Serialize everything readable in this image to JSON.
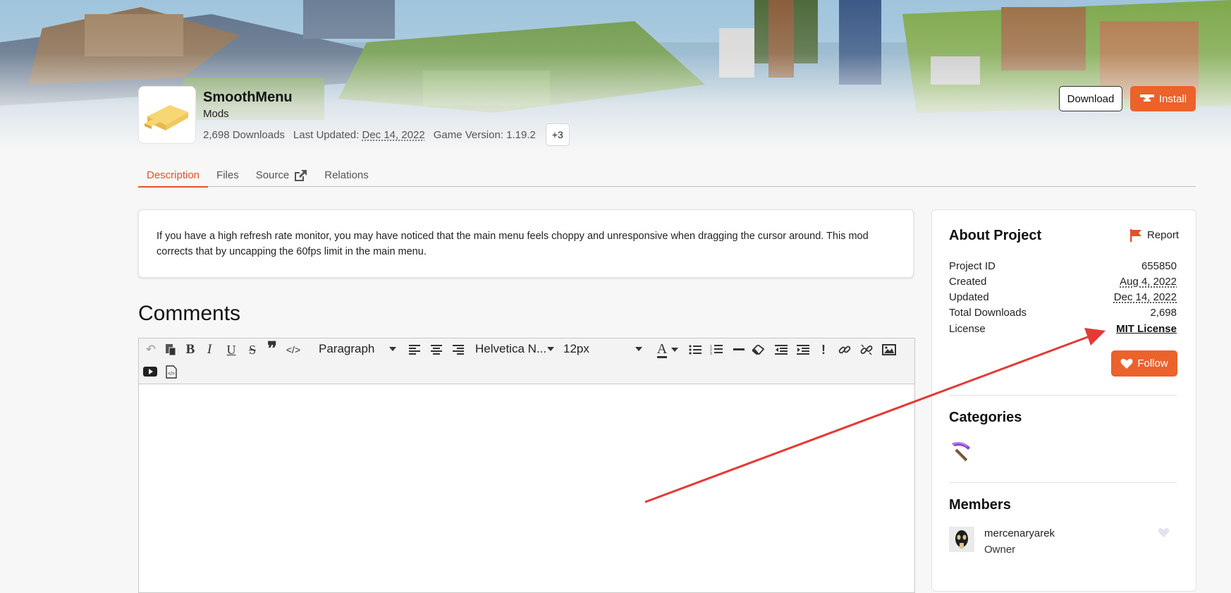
{
  "project": {
    "name": "SmoothMenu",
    "class": "Mods",
    "downloads": "2,698 Downloads",
    "last_updated_label": "Last Updated:",
    "last_updated": "Dec 14, 2022",
    "game_version_label": "Game Version:",
    "game_version": "1.19.2",
    "more_versions": "+3"
  },
  "actions": {
    "download_label": "Download",
    "install_label": "Install"
  },
  "tabs": [
    {
      "label": "Description",
      "active": true
    },
    {
      "label": "Files",
      "active": false
    },
    {
      "label": "Source",
      "active": false
    },
    {
      "label": "Relations",
      "active": false
    }
  ],
  "description": "If you have a high refresh rate monitor, you may have noticed that the main menu feels choppy and unresponsive when dragging the cursor around. This mod corrects that by uncapping the 60fps limit in the main menu.",
  "comments": {
    "title": "Comments",
    "editor": {
      "block_format": "Paragraph",
      "font_family": "Helvetica N...",
      "font_size": "12px"
    }
  },
  "sidebar": {
    "about_title": "About Project",
    "report_label": "Report",
    "rows": [
      {
        "label": "Project ID",
        "value": "655850"
      },
      {
        "label": "Created",
        "value": "Aug 4, 2022"
      },
      {
        "label": "Updated",
        "value": "Dec 14, 2022"
      },
      {
        "label": "Total Downloads",
        "value": "2,698"
      },
      {
        "label": "License",
        "value": "MIT License"
      }
    ],
    "follow_label": "Follow",
    "categories_title": "Categories",
    "category_icon": "pickaxe-icon",
    "members_title": "Members",
    "member": {
      "name": "mercenaryarek",
      "role": "Owner"
    }
  },
  "colors": {
    "accent": "#eb622b",
    "annotation_arrow": "#e53935"
  }
}
